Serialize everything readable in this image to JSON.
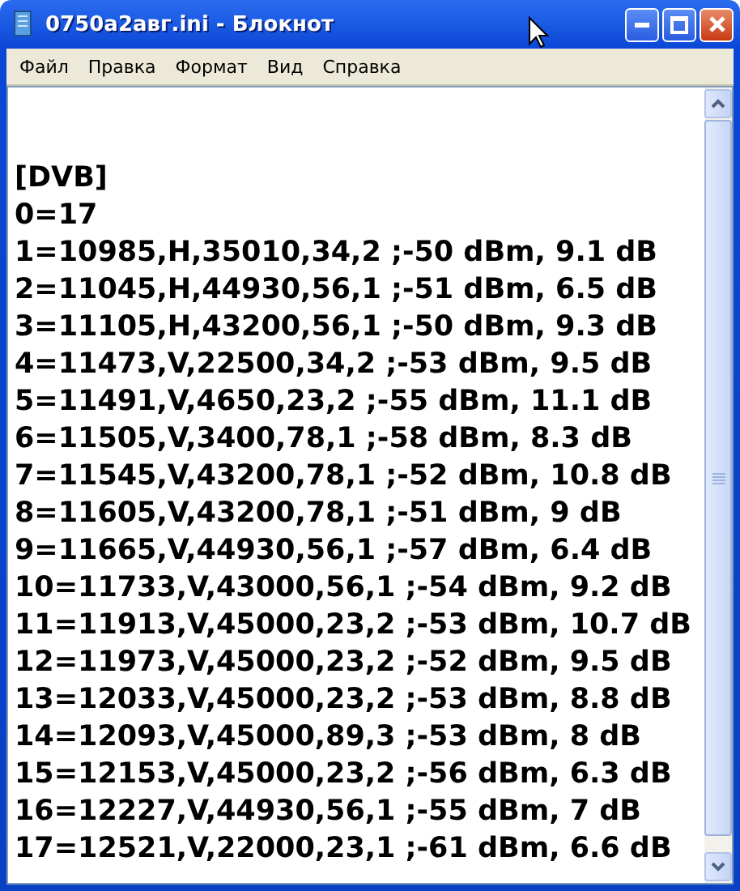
{
  "window": {
    "title": "0750a2авг.ini - Блокнот"
  },
  "menu": [
    "Файл",
    "Правка",
    "Формат",
    "Вид",
    "Справка"
  ],
  "lines": [
    "[DVB]",
    "0=17",
    "1=10985,H,35010,34,2 ;-50 dBm, 9.1 dB",
    "2=11045,H,44930,56,1 ;-51 dBm, 6.5 dB",
    "3=11105,H,43200,56,1 ;-50 dBm, 9.3 dB",
    "4=11473,V,22500,34,2 ;-53 dBm, 9.5 dB",
    "5=11491,V,4650,23,2 ;-55 dBm, 11.1 dB",
    "6=11505,V,3400,78,1 ;-58 dBm, 8.3 dB",
    "7=11545,V,43200,78,1 ;-52 dBm, 10.8 dB",
    "8=11605,V,43200,78,1 ;-51 dBm, 9 dB",
    "9=11665,V,44930,56,1 ;-57 dBm, 6.4 dB",
    "10=11733,V,43000,56,1 ;-54 dBm, 9.2 dB",
    "11=11913,V,45000,23,2 ;-53 dBm, 10.7 dB",
    "12=11973,V,45000,23,2 ;-52 dBm, 9.5 dB",
    "13=12033,V,45000,23,2 ;-53 dBm, 8.8 dB",
    "14=12093,V,45000,89,3 ;-53 dBm, 8 dB",
    "15=12153,V,45000,23,2 ;-56 dBm, 6.3 dB",
    "16=12227,V,44930,56,1 ;-55 dBm, 7 dB",
    "17=12521,V,22000,23,1 ;-61 dBm, 6.6 dB"
  ]
}
